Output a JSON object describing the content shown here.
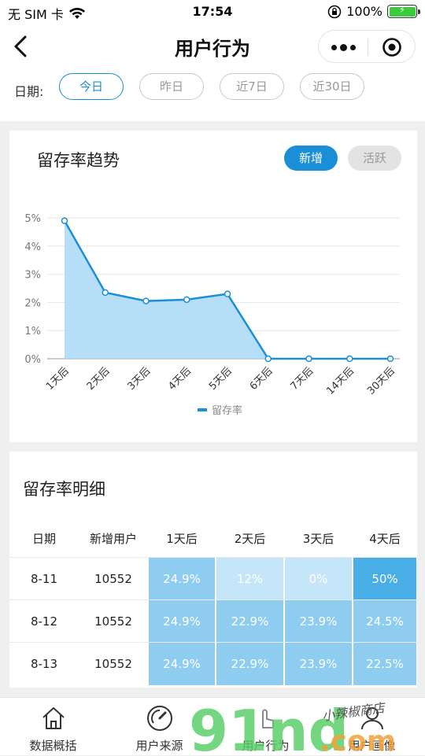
{
  "status_bar": {
    "carrier": "无 SIM 卡",
    "time": "17:54",
    "battery": "100%"
  },
  "nav": {
    "title": "用户行为"
  },
  "date_filter": {
    "label": "日期:",
    "options": [
      "今日",
      "昨日",
      "近7日",
      "近30日"
    ],
    "selected": 0
  },
  "retention_chart": {
    "title": "留存率趋势",
    "toggles": [
      "新增",
      "活跃"
    ],
    "active_toggle": 0
  },
  "chart_data": {
    "type": "area",
    "categories": [
      "1天后",
      "2天后",
      "3天后",
      "4天后",
      "5天后",
      "6天后",
      "7天后",
      "14天后",
      "30天后"
    ],
    "series": [
      {
        "name": "留存率",
        "values": [
          4.9,
          2.35,
          2.05,
          2.1,
          2.3,
          0,
          0,
          0,
          0
        ]
      }
    ],
    "yticks": [
      "0%",
      "1%",
      "2%",
      "3%",
      "4%",
      "5%"
    ],
    "ylim": [
      0,
      5
    ],
    "legend": "bottom",
    "grid": true,
    "colors": {
      "line": "#1a8fd8",
      "fill": "#a9d8f5"
    }
  },
  "retention_table": {
    "title": "留存率明细",
    "headers": [
      "日期",
      "新增用户",
      "1天后",
      "2天后",
      "3天后",
      "4天后"
    ],
    "rows": [
      {
        "date": "8-11",
        "new_users": "10552",
        "values": [
          "24.9%",
          "12%",
          "0%",
          "50%"
        ]
      },
      {
        "date": "8-12",
        "new_users": "10552",
        "values": [
          "24.9%",
          "22.9%",
          "23.9%",
          "24.5%"
        ]
      },
      {
        "date": "8-13",
        "new_users": "10552",
        "values": [
          "24.9%",
          "22.9%",
          "23.9%",
          "22.5%"
        ]
      }
    ],
    "cell_colors": [
      [
        "#8ecdf0",
        "#c4e6f8",
        "#c4e6f8",
        "#4aaee6"
      ],
      [
        "#8ecdf0",
        "#8ecdf0",
        "#8ecdf0",
        "#8ecdf0"
      ],
      [
        "#8ecdf0",
        "#8ecdf0",
        "#8ecdf0",
        "#8ecdf0"
      ]
    ]
  },
  "tab_bar": {
    "tabs": [
      {
        "label": "数据概括",
        "icon": "home-icon"
      },
      {
        "label": "用户来源",
        "icon": "gauge-icon"
      },
      {
        "label": "用户行为",
        "icon": "pointer-icon"
      },
      {
        "label": "用户画像",
        "icon": "person-icon"
      }
    ]
  },
  "watermark": {
    "brand": "91nd",
    "domain": ".com",
    "tagline": "小辣椒商店"
  }
}
